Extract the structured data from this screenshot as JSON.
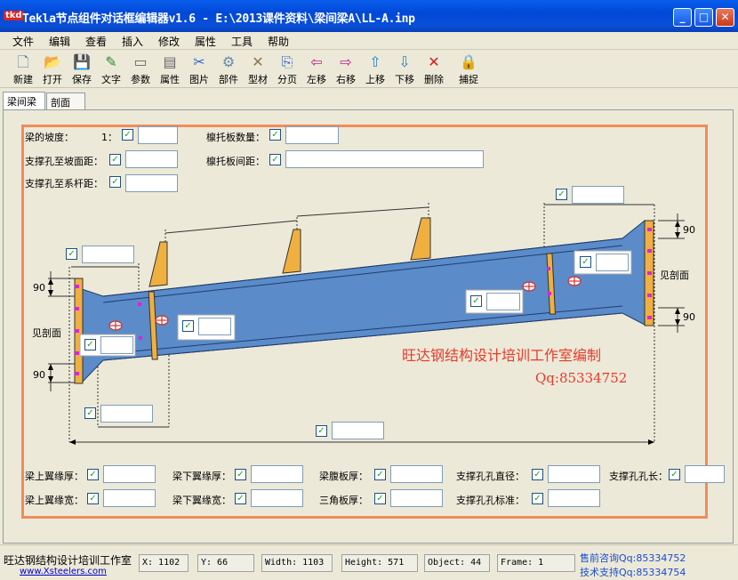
{
  "window": {
    "title": "Tekla节点组件对话框编辑器v1.6 - E:\\2013课件资料\\梁间梁A\\LL-A.inp",
    "app_badge": "tkd",
    "minimize": "_",
    "maximize": "□",
    "close": "✕"
  },
  "menu": [
    "文件",
    "编辑",
    "查看",
    "插入",
    "修改",
    "属性",
    "工具",
    "帮助"
  ],
  "toolbar": [
    {
      "label": "新建",
      "icon": "new-file-icon",
      "glyph": "🗋"
    },
    {
      "label": "打开",
      "icon": "open-folder-icon",
      "glyph": "📂"
    },
    {
      "label": "保存",
      "icon": "save-disk-icon",
      "glyph": "💾"
    },
    {
      "label": "文字",
      "icon": "text-icon",
      "glyph": "✎"
    },
    {
      "label": "参数",
      "icon": "param-icon",
      "glyph": "▭"
    },
    {
      "label": "属性",
      "icon": "attribute-icon",
      "glyph": "▤"
    },
    {
      "label": "图片",
      "icon": "picture-icon",
      "glyph": "✂"
    },
    {
      "label": "部件",
      "icon": "part-icon",
      "glyph": "⚙"
    },
    {
      "label": "型材",
      "icon": "profile-icon",
      "glyph": "✕"
    },
    {
      "label": "分页",
      "icon": "page-icon",
      "glyph": "⎘"
    },
    {
      "label": "左移",
      "icon": "move-left-icon",
      "glyph": "⇦"
    },
    {
      "label": "右移",
      "icon": "move-right-icon",
      "glyph": "⇨"
    },
    {
      "label": "上移",
      "icon": "move-up-icon",
      "glyph": "⇧"
    },
    {
      "label": "下移",
      "icon": "move-down-icon",
      "glyph": "⇩"
    },
    {
      "label": "删除",
      "icon": "delete-icon",
      "glyph": "✕"
    },
    {
      "label": "捕捉",
      "icon": "snap-lock-icon",
      "glyph": "🔒"
    }
  ],
  "tabs": [
    "梁间梁",
    "剖面"
  ],
  "form": {
    "slope_label": "梁的坡度：",
    "slope_ratio": "1：",
    "hole_to_slope_label": "支撑孔至坡面距：",
    "hole_to_tie_label": "支撑孔至系杆距：",
    "purlin_count_label": "檩托板数量：",
    "purlin_spacing_label": "檩托板间距：",
    "dim_90": "90",
    "see_section": "见剖面",
    "top_flange_thk": "梁上翼缘厚：",
    "bot_flange_thk": "梁下翼缘厚：",
    "web_thk": "梁腹板厚：",
    "hole_dia": "支撑孔孔直径：",
    "hole_len": "支撑孔孔长：",
    "top_flange_w": "梁上翼缘宽：",
    "bot_flange_w": "梁下翼缘宽：",
    "tri_thk": "三角板厚：",
    "hole_std": "支撑孔孔标准："
  },
  "watermark": {
    "line1": "旺达钢结构设计培训工作室编制",
    "line2": "Qq:85334752"
  },
  "status": {
    "studio": "旺达钢结构设计培训工作室",
    "site": "www.Xsteelers.com",
    "x": "X: 1102",
    "y": "Y: 66",
    "width": "Width: 1103",
    "height": "Height: 571",
    "object": "Object: 44",
    "frame": "Frame: 1",
    "presale": "售前咨询Qq:85334752",
    "support": "技术支持Qq:85334754"
  },
  "colors": {
    "beam": "#5B8BC9",
    "plate": "#F0B040",
    "frame": "#F08C5A",
    "mark": "#E020E0"
  }
}
